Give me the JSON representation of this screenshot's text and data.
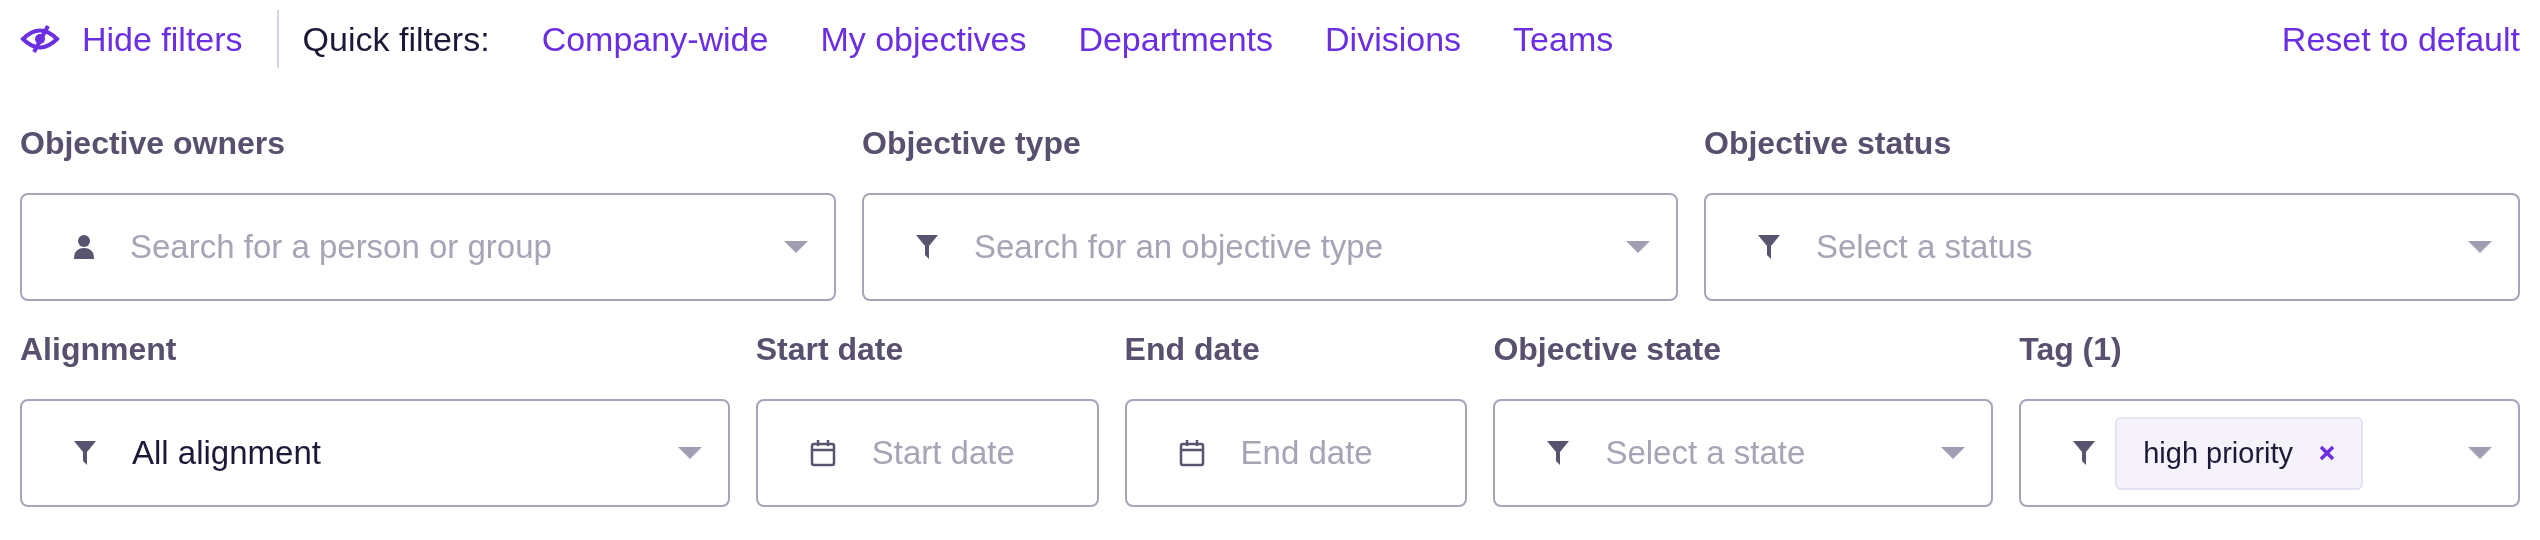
{
  "toolbar": {
    "hide_filters": "Hide filters",
    "quick_filters_label": "Quick filters:",
    "quick_filters": [
      "Company-wide",
      "My objectives",
      "Departments",
      "Divisions",
      "Teams"
    ],
    "reset": "Reset to default"
  },
  "filter_rows": [
    [
      {
        "label": "Objective owners",
        "kind": "person",
        "placeholder": "Search for a person or group"
      },
      {
        "label": "Objective type",
        "kind": "filter",
        "placeholder": "Search for an objective type"
      },
      {
        "label": "Objective status",
        "kind": "filter",
        "placeholder": "Select a status"
      }
    ],
    [
      {
        "label": "Alignment",
        "kind": "filter",
        "value": "All alignment"
      },
      {
        "label": "Start date",
        "kind": "date",
        "placeholder": "Start date"
      },
      {
        "label": "End date",
        "kind": "date",
        "placeholder": "End date"
      },
      {
        "label": "Objective state",
        "kind": "filter",
        "placeholder": "Select a state"
      },
      {
        "label": "Tag (1)",
        "kind": "filter",
        "tags": [
          "high priority"
        ]
      }
    ]
  ]
}
